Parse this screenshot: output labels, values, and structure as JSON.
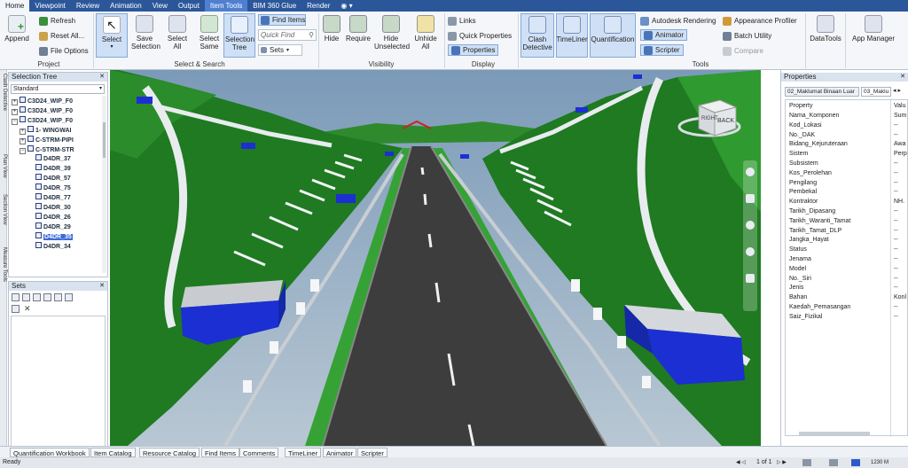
{
  "menu_tabs": [
    "Home",
    "Viewpoint",
    "Review",
    "Animation",
    "View",
    "Output",
    "Item Tools",
    "BIM 360 Glue",
    "Render"
  ],
  "ribbon": {
    "project": {
      "append": "Append",
      "refresh": "Refresh",
      "reset_all": "Reset All...",
      "file_options": "File Options",
      "group": "Project"
    },
    "select_search": {
      "select": "Select",
      "save_selection": "Save Selection",
      "select_all": "Select All",
      "select_same": "Select Same",
      "selection_tree": "Selection Tree",
      "find_items": "Find Items",
      "quick_find": "Quick Find",
      "sets": "Sets",
      "group": "Select & Search"
    },
    "visibility": {
      "hide": "Hide",
      "require": "Require",
      "hide_unselected": "Hide Unselected",
      "unhide_all": "Unhide All",
      "group": "Visibility"
    },
    "display": {
      "links": "Links",
      "quick_properties": "Quick Properties",
      "properties": "Properties",
      "group": "Display"
    },
    "tools": {
      "clash_detective": "Clash Detective",
      "timeliner": "TimeLiner",
      "quantification": "Quantification",
      "autodesk_rendering": "Autodesk Rendering",
      "animator": "Animator",
      "scripter": "Scripter",
      "appearance_profiler": "Appearance Profiler",
      "batch_utility": "Batch Utility",
      "compare": "Compare",
      "group": "Tools"
    },
    "datatools": "DataTools",
    "app_manager": "App Manager"
  },
  "left_strip": [
    "Clash Detective",
    "Plan View",
    "Section View",
    "Measure Tools"
  ],
  "selection_tree": {
    "title": "Selection Tree",
    "dropdown": "Standard",
    "items": [
      {
        "label": "C3D24_WIP_F0",
        "toggle": "+",
        "kind": "file",
        "indent": 0
      },
      {
        "label": "C3D24_WIP_F0",
        "toggle": "+",
        "kind": "file",
        "indent": 0
      },
      {
        "label": "C3D24_WIP_F0",
        "toggle": "−",
        "kind": "file",
        "indent": 0
      },
      {
        "label": "1- WINGWAI",
        "toggle": "+",
        "kind": "layer",
        "indent": 1
      },
      {
        "label": "C-STRM-PIPI",
        "toggle": "+",
        "kind": "layer",
        "indent": 1
      },
      {
        "label": "C-STRM-STR",
        "toggle": "−",
        "kind": "layer",
        "indent": 1
      },
      {
        "label": "D4DR_37",
        "toggle": "",
        "kind": "obj",
        "indent": 2
      },
      {
        "label": "D4DR_39",
        "toggle": "",
        "kind": "obj",
        "indent": 2
      },
      {
        "label": "D4DR_57",
        "toggle": "",
        "kind": "obj",
        "indent": 2
      },
      {
        "label": "D4DR_75",
        "toggle": "",
        "kind": "obj",
        "indent": 2
      },
      {
        "label": "D4DR_77",
        "toggle": "",
        "kind": "obj",
        "indent": 2
      },
      {
        "label": "D4DR_30",
        "toggle": "",
        "kind": "obj",
        "indent": 2
      },
      {
        "label": "D4DR_26",
        "toggle": "",
        "kind": "obj",
        "indent": 2
      },
      {
        "label": "D4DR_29",
        "toggle": "",
        "kind": "obj",
        "indent": 2
      },
      {
        "label": "D4DR_35",
        "toggle": "",
        "kind": "obj",
        "indent": 2,
        "highlight": true
      },
      {
        "label": "D4DR_34",
        "toggle": "",
        "kind": "obj",
        "indent": 2
      }
    ]
  },
  "sets_panel": {
    "title": "Sets"
  },
  "viewcube": {
    "left": "RIGHT",
    "front": "BACK"
  },
  "properties": {
    "title": "Properties",
    "tab1": "02_Maklumat Binaan Luar",
    "tab2": "03_Maklu",
    "header_property": "Property",
    "header_value": "Valu",
    "rows": [
      {
        "name": "Nama_Komponen",
        "value": "Sum"
      },
      {
        "name": "Kod_Lokasi",
        "value": "--"
      },
      {
        "name": "No._DAK",
        "value": "--"
      },
      {
        "name": "Bidang_Kejuruteraan",
        "value": "Awa"
      },
      {
        "name": "Sistem",
        "value": "Perp"
      },
      {
        "name": "Subsistem",
        "value": "--"
      },
      {
        "name": "Kos_Perolehan",
        "value": "--"
      },
      {
        "name": "Pengilang",
        "value": "--"
      },
      {
        "name": "Pembekal",
        "value": "--"
      },
      {
        "name": "Kontraktor",
        "value": "NH."
      },
      {
        "name": "Tarikh_Dipasang",
        "value": "--"
      },
      {
        "name": "Tarikh_Waranti_Tamat",
        "value": "--"
      },
      {
        "name": "Tarikh_Tamat_DLP",
        "value": "--"
      },
      {
        "name": "Jangka_Hayat",
        "value": "--"
      },
      {
        "name": "Status",
        "value": "--"
      },
      {
        "name": "Jenama",
        "value": "--"
      },
      {
        "name": "Model",
        "value": "--"
      },
      {
        "name": "No._Siri",
        "value": "--"
      },
      {
        "name": "Jenis",
        "value": "--"
      },
      {
        "name": "Bahan",
        "value": "Konl"
      },
      {
        "name": "Kaedah_Pemasangan",
        "value": "--"
      },
      {
        "name": "Saiz_Fizikal",
        "value": "--"
      }
    ]
  },
  "bottom_tabs": [
    "Quantification Workbook",
    "Item Catalog",
    "Resource Catalog",
    "Find Items",
    "Comments",
    "TimeLiner",
    "Animator",
    "Scripter"
  ],
  "status": {
    "ready": "Ready",
    "page": "1 of 1",
    "size": "1230 M"
  },
  "colors": {
    "menubar": "#2b579a",
    "grass": "#1e7a20",
    "road": "#3a3a3a",
    "structure": "#1b2fd0",
    "highlight": "#3d6ad6"
  }
}
